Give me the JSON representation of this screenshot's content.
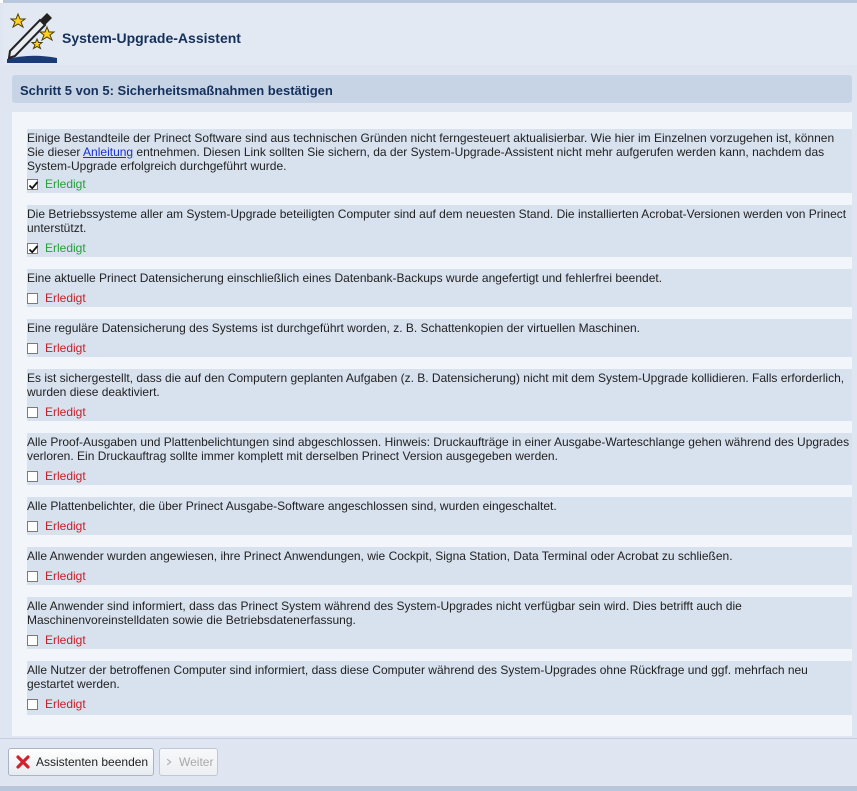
{
  "app": {
    "title": "System-Upgrade-Assistent",
    "icon": "magic-wand-stars-icon"
  },
  "step": {
    "title": "Schritt 5 von 5: Sicherheitsmaßnahmen bestätigen"
  },
  "colors": {
    "done_checked": "#21a336",
    "done_unchecked": "#c8202a",
    "link": "#1a2fd0",
    "title": "#14305a"
  },
  "items": [
    {
      "text_before": "Einige Bestandteile der Prinect Software sind aus technischen Gründen nicht ferngesteuert aktualisierbar. Wie hier im Einzelnen vorzugehen ist, können Sie dieser ",
      "link": "Anleitung",
      "text_after": " entnehmen. Diesen Link sollten Sie sichern, da der System-Upgrade-Assistent nicht mehr aufgerufen werden kann, nachdem das System-Upgrade erfolgreich durchgeführt wurde.",
      "checked": true,
      "label": "Erledigt"
    },
    {
      "text": "Die Betriebssysteme aller am System-Upgrade beteiligten Computer sind auf dem neuesten Stand. Die installierten Acrobat-Versionen werden von Prinect unterstützt.",
      "checked": true,
      "label": "Erledigt"
    },
    {
      "text": "Eine aktuelle Prinect Datensicherung einschließlich eines Datenbank-Backups wurde angefertigt und fehlerfrei beendet.",
      "checked": false,
      "label": "Erledigt"
    },
    {
      "text": "Eine reguläre Datensicherung des Systems ist durchgeführt worden, z. B. Schattenkopien der virtuellen Maschinen.",
      "checked": false,
      "label": "Erledigt"
    },
    {
      "text": "Es ist sichergestellt, dass die auf den Computern geplanten Aufgaben (z. B. Datensicherung) nicht mit dem System-Upgrade kollidieren. Falls erforderlich, wurden diese deaktiviert.",
      "checked": false,
      "label": "Erledigt"
    },
    {
      "text": "Alle Proof-Ausgaben und Plattenbelichtungen sind abgeschlossen. Hinweis: Druckaufträge in einer Ausgabe-Warteschlange gehen während des Upgrades verloren. Ein Druckauftrag sollte immer komplett mit derselben Prinect Version ausgegeben werden.",
      "checked": false,
      "label": "Erledigt"
    },
    {
      "text": "Alle Plattenbelichter, die über Prinect Ausgabe-Software angeschlossen sind, wurden eingeschaltet.",
      "checked": false,
      "label": "Erledigt"
    },
    {
      "text": "Alle Anwender wurden angewiesen, ihre Prinect Anwendungen, wie Cockpit, Signa Station, Data Terminal oder Acrobat zu schließen.",
      "checked": false,
      "label": "Erledigt"
    },
    {
      "text": "Alle Anwender sind informiert, dass das Prinect System während des System-Upgrades nicht verfügbar sein wird. Dies betrifft auch die Maschinenvoreinstelldaten sowie die Betriebsdatenerfassung.",
      "checked": false,
      "label": "Erledigt"
    },
    {
      "text": "Alle Nutzer der betroffenen Computer sind informiert, dass diese Computer während des System-Upgrades ohne Rückfrage und ggf. mehrfach neu gestartet werden.",
      "checked": false,
      "label": "Erledigt"
    }
  ],
  "footer": {
    "finish_button": "Assistenten beenden",
    "finish_icon": "red-x-icon",
    "next_button": "Weiter",
    "next_icon": "chevron-right-icon"
  }
}
